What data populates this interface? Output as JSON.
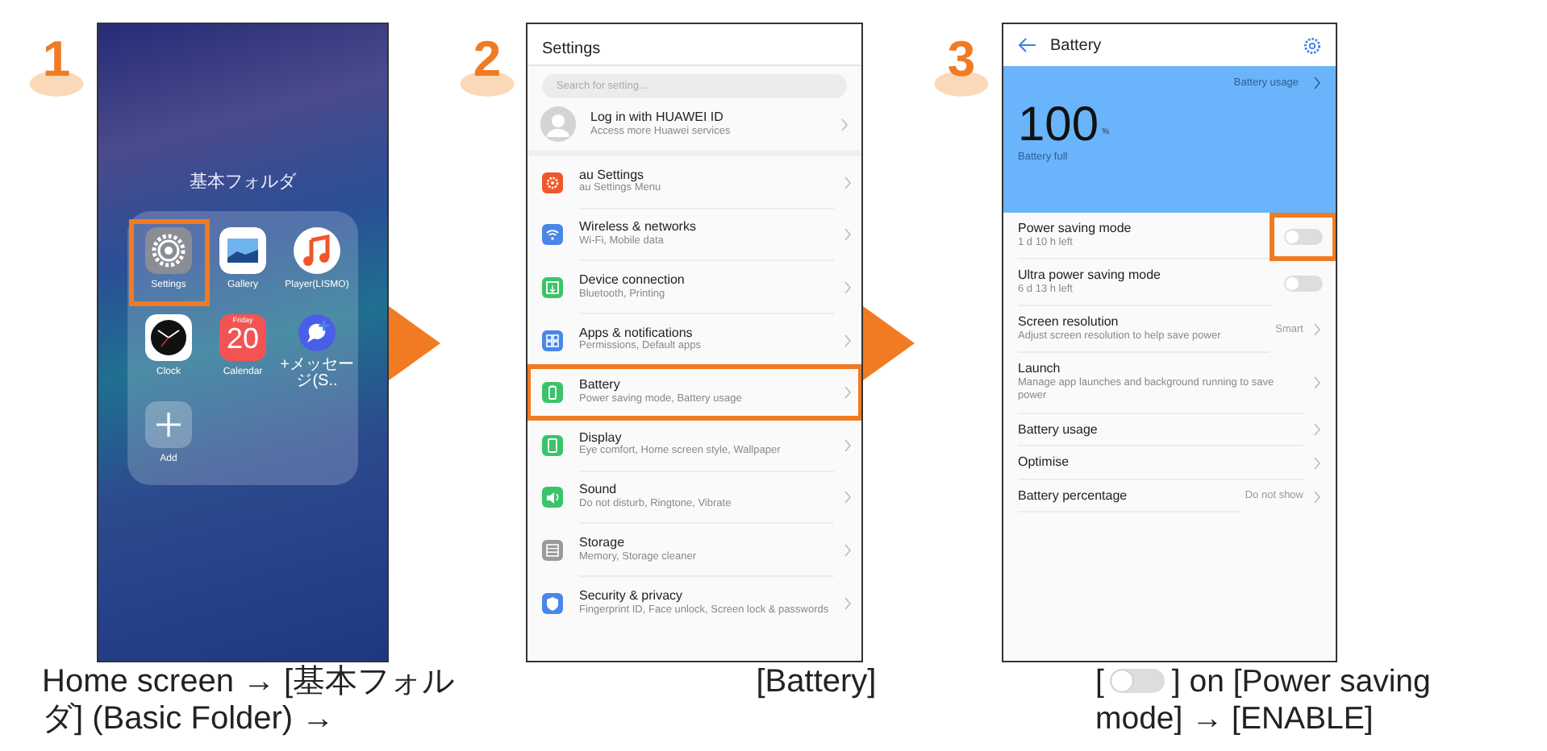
{
  "steps": [
    {
      "number": "1",
      "kind": "home",
      "folder_title": "基本フォルダ",
      "apps": [
        {
          "kind": "settings",
          "label": "Settings",
          "highlighted": true
        },
        {
          "kind": "gallery",
          "label": "Gallery",
          "highlighted": false
        },
        {
          "kind": "music",
          "label": "Player(LISMO)",
          "highlighted": false
        },
        {
          "kind": "clock",
          "label": "Clock",
          "highlighted": false
        },
        {
          "kind": "calendar",
          "label": "Calendar",
          "day": "Friday",
          "date": "20",
          "highlighted": false
        },
        {
          "kind": "message",
          "label": "+メッセージ(S..",
          "highlighted": false
        },
        {
          "kind": "add",
          "label": "Add",
          "highlighted": false
        }
      ],
      "caption": [
        {
          "kind": "text",
          "text": "Home screen → [基本フォルダ] (Basic Folder) →"
        }
      ]
    },
    {
      "number": "2",
      "kind": "settings",
      "title": "Settings",
      "search": {
        "placeholder": "Search for setting..."
      },
      "account": {
        "title": "Log in with HUAWEI ID",
        "subtitle": "Access more Huawei services"
      },
      "items": [
        {
          "kind": "gear",
          "color": "#f0582a",
          "title": "au Settings",
          "subtitle": "au Settings Menu",
          "highlighted": false
        },
        {
          "kind": "wifi",
          "color": "#4a86e8",
          "title": "Wireless & networks",
          "subtitle": "Wi-Fi, Mobile data",
          "highlighted": false
        },
        {
          "kind": "device",
          "color": "#3cc36a",
          "title": "Device connection",
          "subtitle": "Bluetooth, Printing",
          "highlighted": false
        },
        {
          "kind": "apps",
          "color": "#4a86e8",
          "title": "Apps & notifications",
          "subtitle": "Permissions, Default apps",
          "highlighted": false
        },
        {
          "kind": "battery",
          "color": "#3cc36a",
          "title": "Battery",
          "subtitle": "Power saving mode, Battery usage",
          "highlighted": true
        },
        {
          "kind": "display",
          "color": "#3cc36a",
          "title": "Display",
          "subtitle": "Eye comfort, Home screen style, Wallpaper",
          "highlighted": false
        },
        {
          "kind": "sound",
          "color": "#3cc36a",
          "title": "Sound",
          "subtitle": "Do not disturb, Ringtone, Vibrate",
          "highlighted": false
        },
        {
          "kind": "storage",
          "color": "#9a9a9a",
          "title": "Storage",
          "subtitle": "Memory, Storage cleaner",
          "highlighted": false
        },
        {
          "kind": "security",
          "color": "#4a86e8",
          "title": "Security & privacy",
          "subtitle": "Fingerprint ID, Face unlock, Screen lock & passwords",
          "highlighted": false
        }
      ],
      "caption": [
        {
          "kind": "text",
          "text": "[Battery]"
        }
      ]
    },
    {
      "number": "3",
      "kind": "battery",
      "title": "Battery",
      "usage_link": "Battery usage",
      "level_text": "100",
      "unit": "%",
      "status": "Battery full",
      "rows": [
        {
          "kind": "toggle",
          "title": "Power saving mode",
          "subtitle": "1 d 10 h left",
          "on": false,
          "highlighted": true
        },
        {
          "kind": "toggle",
          "title": "Ultra power saving mode",
          "subtitle": "6 d 13 h left",
          "on": false,
          "highlighted": false
        },
        {
          "kind": "link",
          "title": "Screen resolution",
          "subtitle": "Adjust screen resolution to help save power",
          "value": "Smart",
          "highlighted": false
        },
        {
          "kind": "link",
          "title": "Launch",
          "subtitle": "Manage app launches and background running to save power",
          "highlighted": false
        },
        {
          "kind": "link",
          "title": "Battery usage",
          "highlighted": false
        },
        {
          "kind": "link",
          "title": "Optimise",
          "highlighted": false
        },
        {
          "kind": "link",
          "title": "Battery percentage",
          "value": "Do not show",
          "highlighted": false
        }
      ],
      "caption": [
        {
          "kind": "text",
          "text": "["
        },
        {
          "kind": "toggle",
          "on": false
        },
        {
          "kind": "text",
          "text": "] on [Power saving"
        },
        {
          "kind": "text",
          "text": "mode] → [ENABLE]"
        }
      ]
    }
  ]
}
